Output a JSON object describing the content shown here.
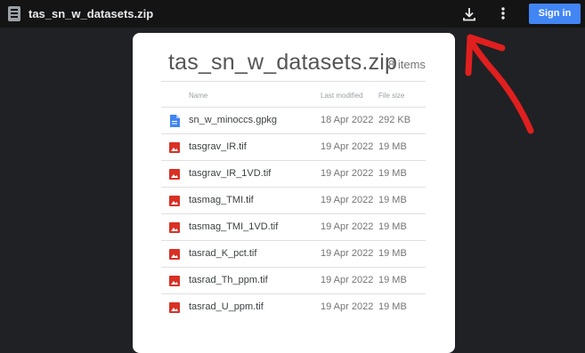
{
  "app": {
    "title": "tas_sn_w_datasets.zip",
    "signin_label": "Sign in"
  },
  "icons": {
    "archive": "zip-file-icon",
    "download": "download-icon",
    "more": "more-vert-icon",
    "doc": "document-icon",
    "image": "image-icon"
  },
  "colors": {
    "signin_bg": "#4285f4",
    "doc_icon": "#4285f4",
    "image_icon": "#d93025",
    "annotation_arrow": "#e01f1f"
  },
  "dialog": {
    "title": "tas_sn_w_datasets.zip",
    "count": "8 items",
    "columns": {
      "name": "Name",
      "modified": "Last modified",
      "size": "File size"
    },
    "files": [
      {
        "name": "sn_w_minoccs.gpkg",
        "modified": "18 Apr 2022",
        "size": "292 KB",
        "icon": "document-icon"
      },
      {
        "name": "tasgrav_IR.tif",
        "modified": "19 Apr 2022",
        "size": "19 MB",
        "icon": "image-icon"
      },
      {
        "name": "tasgrav_IR_1VD.tif",
        "modified": "19 Apr 2022",
        "size": "19 MB",
        "icon": "image-icon"
      },
      {
        "name": "tasmag_TMI.tif",
        "modified": "19 Apr 2022",
        "size": "19 MB",
        "icon": "image-icon"
      },
      {
        "name": "tasmag_TMI_1VD.tif",
        "modified": "19 Apr 2022",
        "size": "19 MB",
        "icon": "image-icon"
      },
      {
        "name": "tasrad_K_pct.tif",
        "modified": "19 Apr 2022",
        "size": "19 MB",
        "icon": "image-icon"
      },
      {
        "name": "tasrad_Th_ppm.tif",
        "modified": "19 Apr 2022",
        "size": "19 MB",
        "icon": "image-icon"
      },
      {
        "name": "tasrad_U_ppm.tif",
        "modified": "19 Apr 2022",
        "size": "19 MB",
        "icon": "image-icon"
      }
    ]
  }
}
